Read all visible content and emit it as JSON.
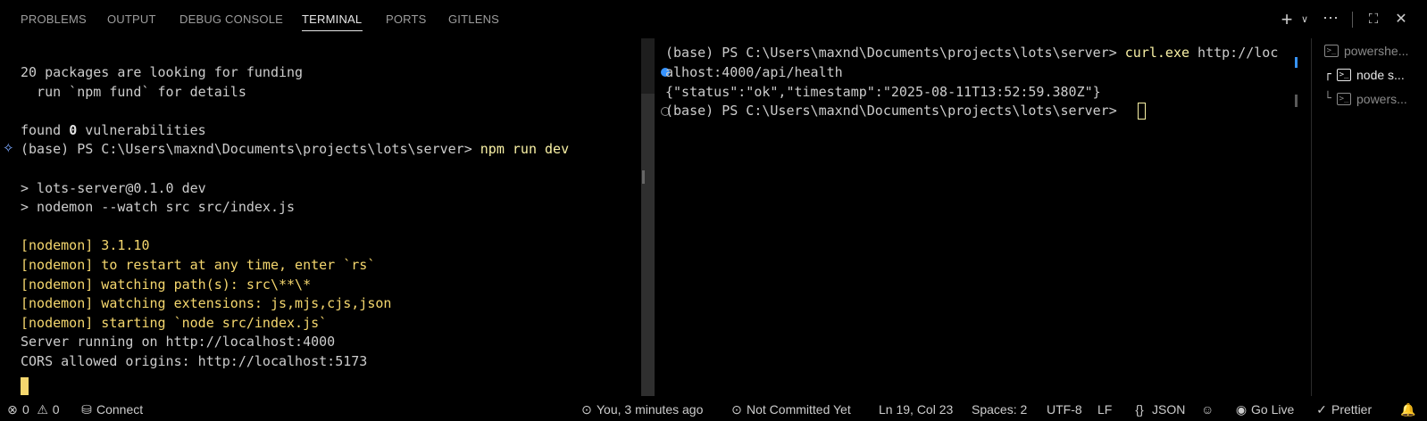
{
  "panel": {
    "tabs": [
      {
        "label": "PROBLEMS"
      },
      {
        "label": "OUTPUT"
      },
      {
        "label": "DEBUG CONSOLE"
      },
      {
        "label": "TERMINAL"
      },
      {
        "label": "PORTS"
      },
      {
        "label": "GITLENS"
      }
    ],
    "active_tab": "TERMINAL",
    "actions": [
      "plus-icon",
      "chevron-down-icon",
      "more-icon",
      "maximize-icon",
      "close-icon"
    ]
  },
  "left_terminal": {
    "lines": [
      "20 packages are looking for funding",
      "  run `npm fund` for details",
      "",
      "found ",
      "(base) PS C:\\Users\\maxnd\\Documents\\projects\\lots\\server> ",
      "",
      "> lots-server@0.1.0 dev",
      "> nodemon --watch src src/index.js",
      "",
      "[nodemon] 3.1.10",
      "[nodemon] to restart at any time, enter `rs`",
      "[nodemon] watching path(s): src\\**\\*",
      "[nodemon] watching extensions: js,mjs,cjs,json",
      "[nodemon] starting `node src/index.js`",
      "Server running on http://localhost:4000",
      "CORS allowed origins: http://localhost:5173"
    ],
    "found_count": "0",
    "found_suffix": " vulnerabilities",
    "command": "npm run dev"
  },
  "right_terminal": {
    "prompt1": "(base) PS C:\\Users\\maxnd\\Documents\\projects\\lots\\server> ",
    "cmd1a": "curl.exe",
    "cmd1b": " http://loc",
    "cmd1c": "alhost:4000/api/health",
    "output": "{\"status\":\"ok\",\"timestamp\":\"2025-08-11T13:52:59.380Z\"}",
    "prompt2": "(base) PS C:\\Users\\maxnd\\Documents\\projects\\lots\\server> "
  },
  "terminal_list": [
    {
      "label": "powershe...",
      "icon": "terminal-icon",
      "active": false
    },
    {
      "label": "node s...",
      "icon": "terminal-icon",
      "active": true
    },
    {
      "label": "powers...",
      "icon": "terminal-icon",
      "active": false
    }
  ],
  "status_bar": {
    "errors": "0",
    "warnings": "0",
    "connect": "Connect",
    "blame": "You, 3 minutes ago",
    "commit": "Not Committed Yet",
    "position": "Ln 19, Col 23",
    "spaces": "Spaces: 2",
    "encoding": "UTF-8",
    "eol": "LF",
    "language": "JSON",
    "golive": "Go Live",
    "prettier": "Prettier"
  },
  "colors": {
    "yellow_text": "#f9f1a5",
    "nodemon_text": "#f5d76e",
    "accent_blue": "#3794ff"
  }
}
